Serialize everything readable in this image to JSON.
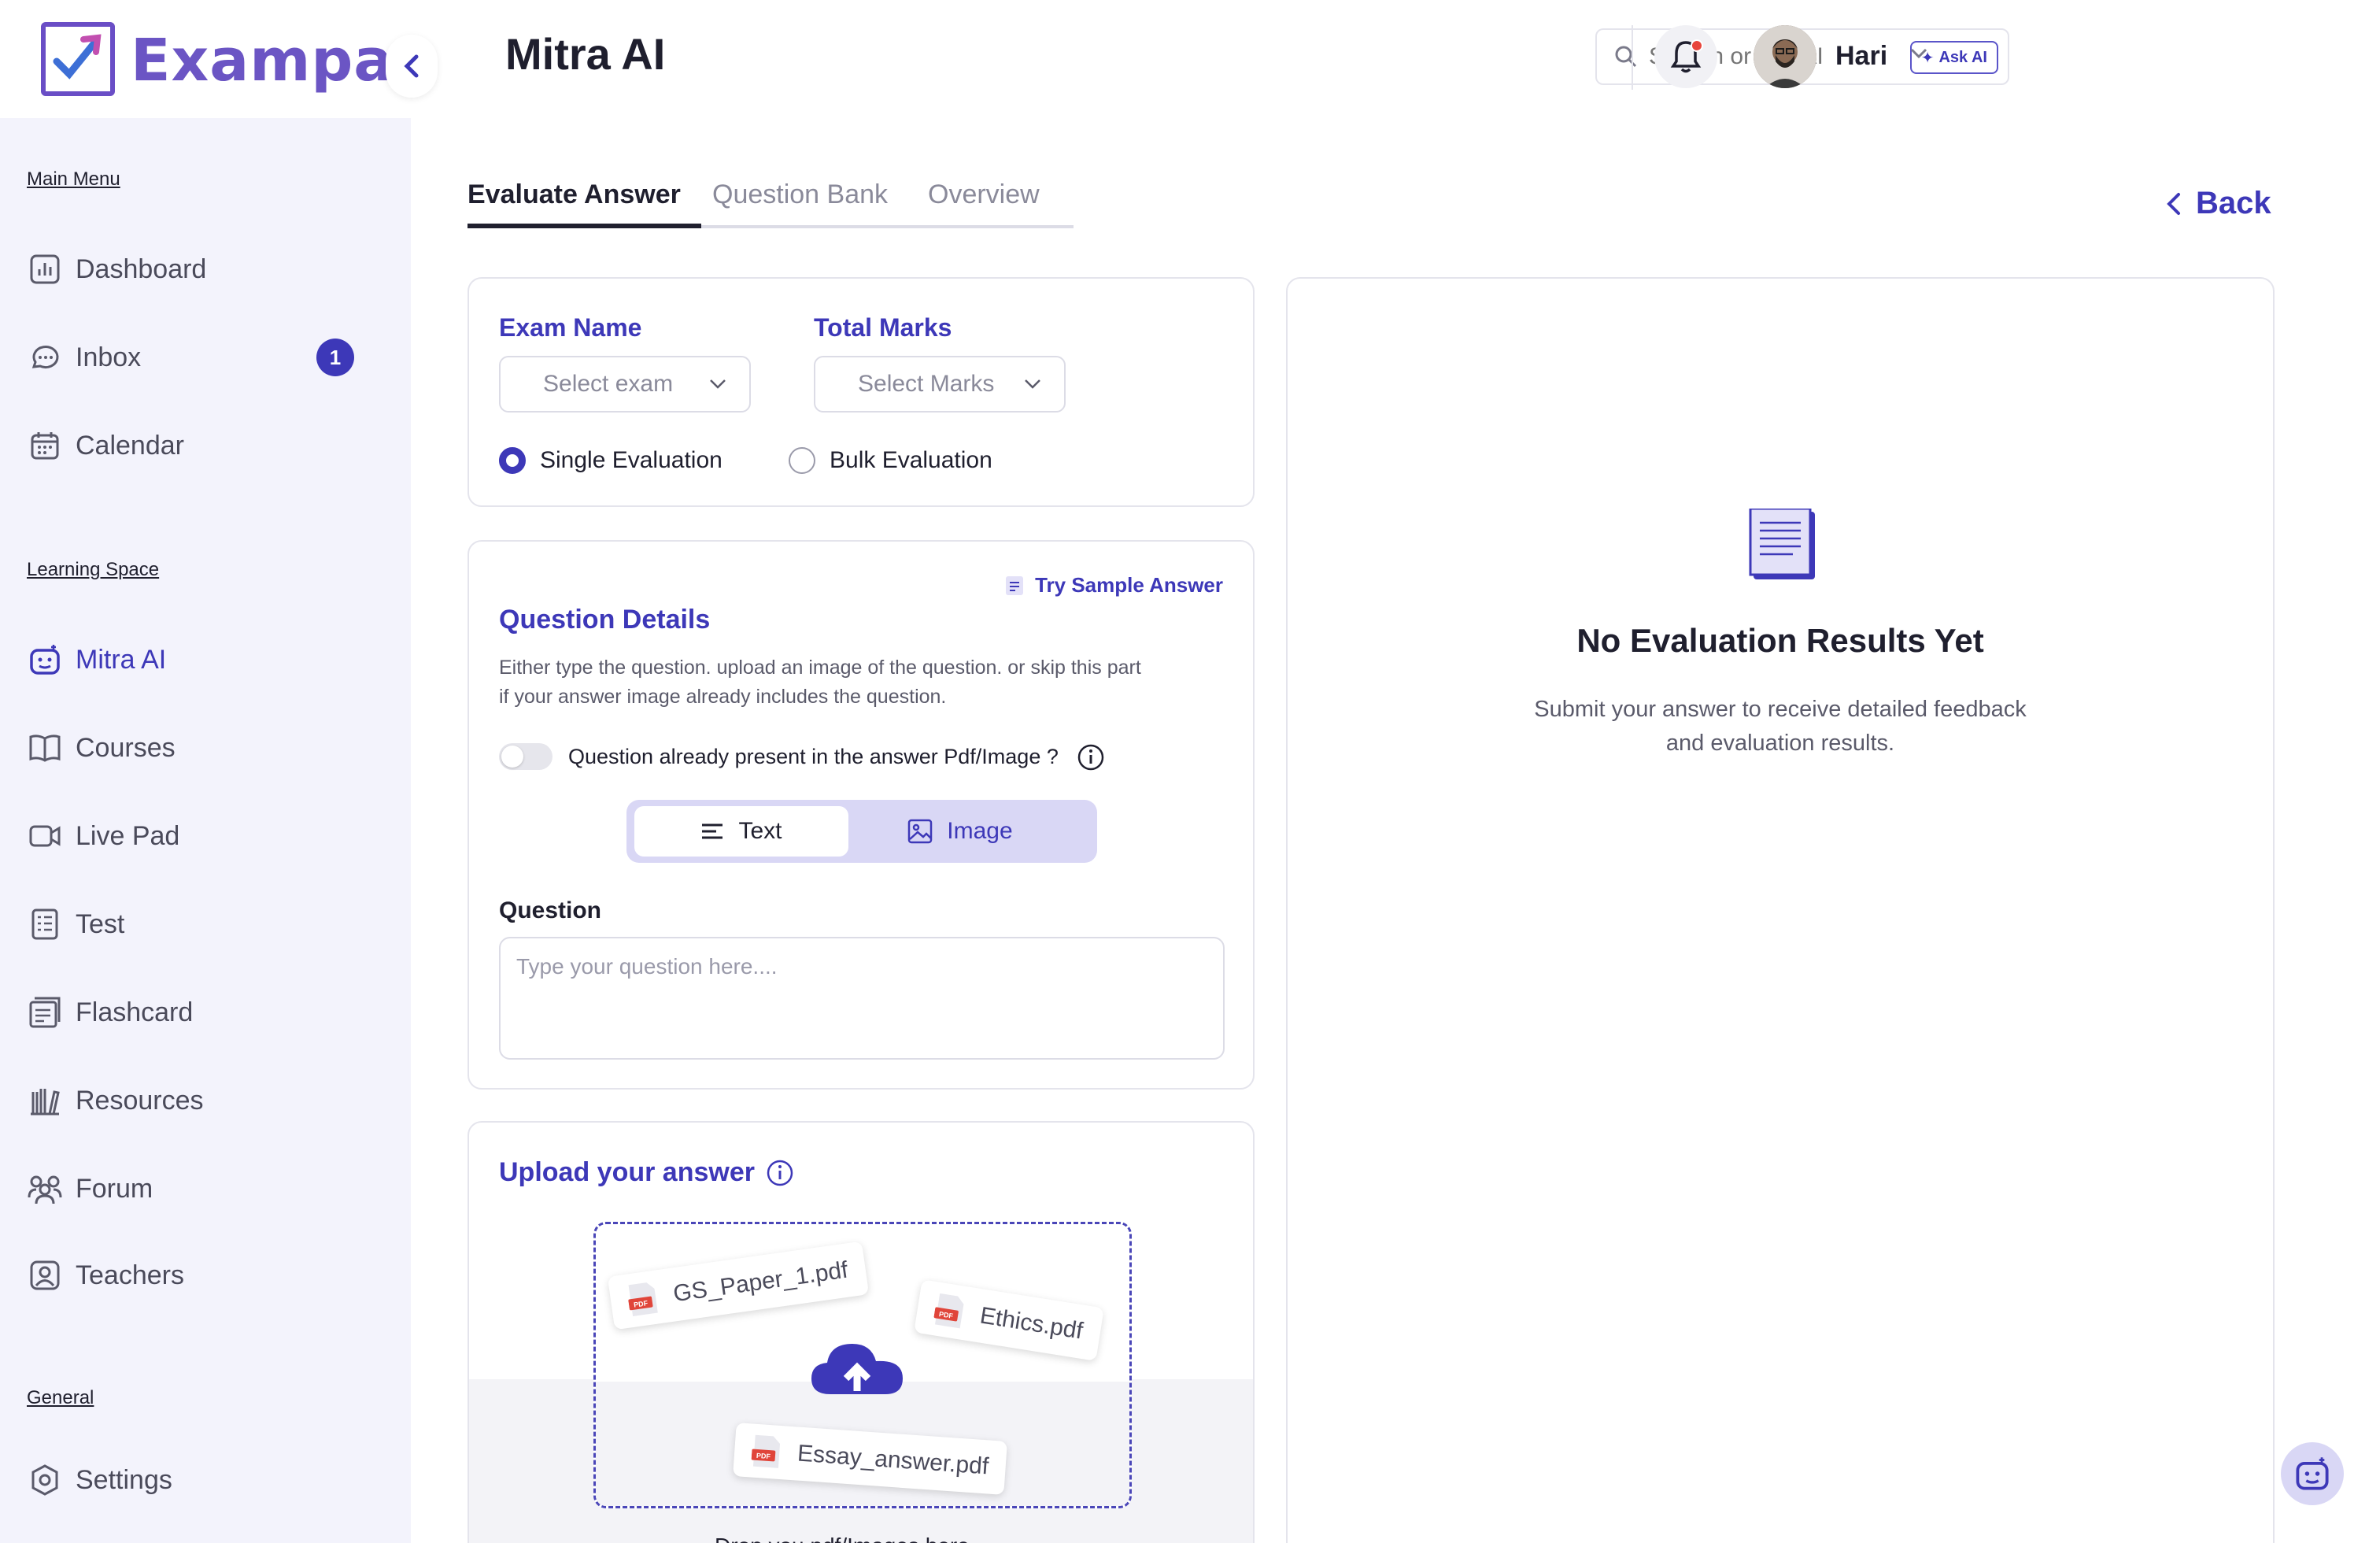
{
  "brand": {
    "name": "Exampad",
    "accent": "#3d38b8",
    "logo_color": "#6b55c4"
  },
  "header": {
    "title": "Mitra AI",
    "search_placeholder": "Search or Ask AI",
    "ask_ai_label": "Ask AI",
    "user_name": "Hari"
  },
  "sidebar": {
    "sections": [
      {
        "label": "Main Menu"
      },
      {
        "label": "Learning Space"
      },
      {
        "label": "General"
      }
    ],
    "items": [
      {
        "label": "Dashboard",
        "icon": "chart-icon"
      },
      {
        "label": "Inbox",
        "icon": "chat-icon",
        "badge": "1"
      },
      {
        "label": "Calendar",
        "icon": "calendar-icon"
      },
      {
        "label": "Mitra AI",
        "icon": "robot-icon",
        "active": true
      },
      {
        "label": "Courses",
        "icon": "book-icon"
      },
      {
        "label": "Live Pad",
        "icon": "video-icon"
      },
      {
        "label": "Test",
        "icon": "test-icon"
      },
      {
        "label": "Flashcard",
        "icon": "flashcard-icon"
      },
      {
        "label": "Resources",
        "icon": "library-icon"
      },
      {
        "label": "Forum",
        "icon": "forum-icon"
      },
      {
        "label": "Teachers",
        "icon": "teacher-icon"
      },
      {
        "label": "Settings",
        "icon": "settings-icon"
      }
    ]
  },
  "tabs": [
    {
      "label": "Evaluate Answer",
      "active": true
    },
    {
      "label": "Question Bank"
    },
    {
      "label": "Overview"
    }
  ],
  "back_label": "Back",
  "exam_card": {
    "exam_name_label": "Exam Name",
    "exam_select": "Select exam",
    "total_marks_label": "Total Marks",
    "marks_select": "Select Marks",
    "radio_single": "Single Evaluation",
    "radio_bulk": "Bulk Evaluation",
    "selected": "Single Evaluation"
  },
  "question_card": {
    "sample_link": "Try Sample Answer",
    "title": "Question Details",
    "helper_line1": "Either type the question. upload an image of the question. or skip this part",
    "helper_line2": "if your answer image already includes the question.",
    "toggle_label": "Question already present in the answer Pdf/Image ?",
    "toggle_on": false,
    "seg_text": "Text",
    "seg_image": "Image",
    "question_label": "Question",
    "question_placeholder": "Type your question here...."
  },
  "upload_card": {
    "title": "Upload your answer",
    "files": [
      "GS_Paper_1.pdf",
      "Ethics.pdf",
      "Essay_answer.pdf"
    ],
    "pdf_tag": "PDF",
    "drop_hint": "Drop you pdf/Images here"
  },
  "results_panel": {
    "title": "No Evaluation Results Yet",
    "subtitle_line1": "Submit your answer to receive detailed feedback",
    "subtitle_line2": "and evaluation results."
  }
}
